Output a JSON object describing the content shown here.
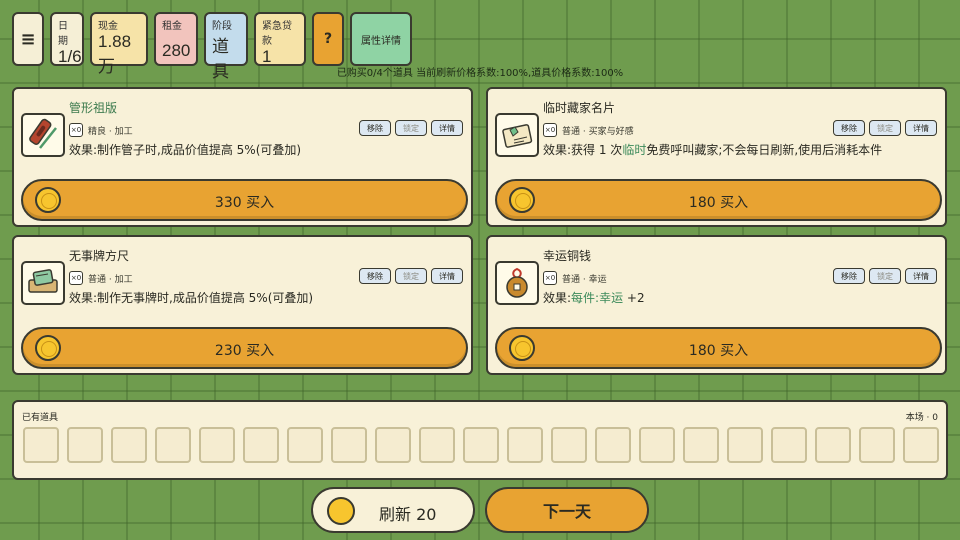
{
  "topbar": {
    "menu_icon": "hamburger-menu-icon",
    "date": {
      "label": "日期",
      "value": "1/6"
    },
    "cash": {
      "label": "现金",
      "value": "1.88万"
    },
    "rent": {
      "label": "租金",
      "value": "280"
    },
    "stage": {
      "label": "阶段",
      "value": "道具"
    },
    "loan": {
      "label": "紧急贷款",
      "value": "1"
    },
    "help_label": "?",
    "attr_label": "属性详情"
  },
  "status_line": "已购买0/4个道具 当前刷新价格系数:100%,道具价格系数:100%",
  "cards": [
    {
      "name": "管形祖版",
      "badge": "×0",
      "tags": "精良 · 加工",
      "effect": "效果:制作管子时,成品价值提高 5%(可叠加)",
      "price": "330 买入",
      "buttons": {
        "remove": "移除",
        "lock": "锁定",
        "detail": "详情"
      }
    },
    {
      "name": "临时藏家名片",
      "badge": "×0",
      "tags": "普通 · 买家与好感",
      "effect_pre": "效果:获得 1 次",
      "effect_hl": "临时",
      "effect_post": "免费呼叫藏家;不会每日刷新,使用后消耗本件",
      "price": "180 买入",
      "buttons": {
        "remove": "移除",
        "lock": "锁定",
        "detail": "详情"
      }
    },
    {
      "name": "无事牌方尺",
      "badge": "×0",
      "tags": "普通 · 加工",
      "effect": "效果:制作无事牌时,成品价值提高 5%(可叠加)",
      "price": "230 买入",
      "buttons": {
        "remove": "移除",
        "lock": "锁定",
        "detail": "详情"
      }
    },
    {
      "name": "幸运铜钱",
      "badge": "×0",
      "tags": "普通 · 幸运",
      "effect_pre": "效果:",
      "effect_hl": "每件:幸运",
      "effect_post": " +2",
      "price": "180 买入",
      "buttons": {
        "remove": "移除",
        "lock": "锁定",
        "detail": "详情"
      }
    }
  ],
  "inventory": {
    "title": "已有道具",
    "count": "本场 · 0"
  },
  "footer": {
    "refresh_label": "刷新 20",
    "next_day_label": "下一天"
  }
}
